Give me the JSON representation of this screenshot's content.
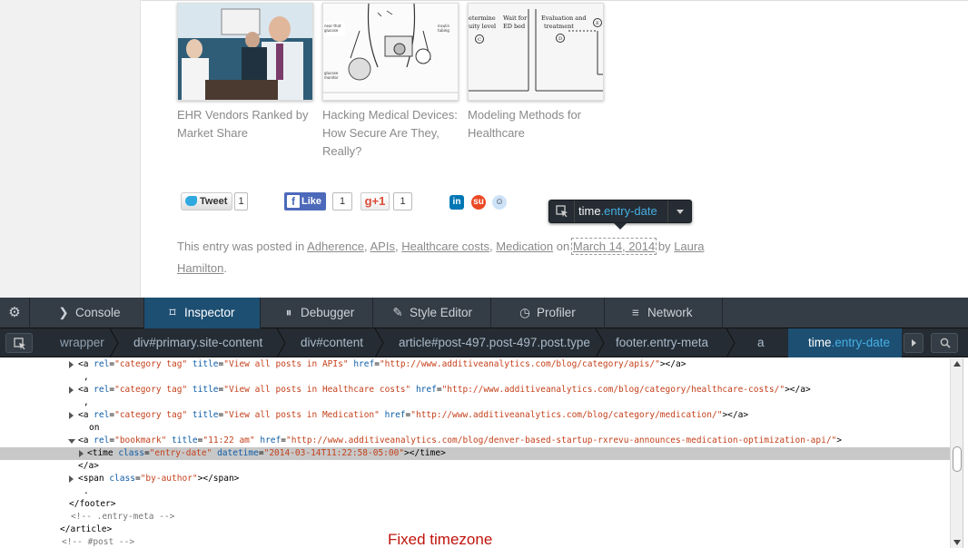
{
  "related_posts": [
    {
      "title": "EHR Vendors Ranked by Market Share"
    },
    {
      "title": "Hacking Medical Devices: How Secure Are They, Really?"
    },
    {
      "title": "Modeling Methods for Healthcare"
    }
  ],
  "thumb3_labels": {
    "a": "etermine",
    "b": "uity level",
    "c": "Wait for",
    "d": "ED bed",
    "e": "Evaluation and",
    "f": "treatment",
    "g": "C",
    "h": "D",
    "i": "E"
  },
  "share": {
    "tweet_label": "Tweet",
    "tweet_count": "1",
    "like_label": "Like",
    "like_count": "1",
    "gplus_label": "g+1",
    "gplus_count": "1"
  },
  "infobar": {
    "tag": "time",
    "class": ".entry-date"
  },
  "entry_meta": {
    "prefix": "This entry was posted in",
    "categories": [
      "Adherence",
      "APIs",
      "Healthcare costs",
      "Medication"
    ],
    "on": "on",
    "date": "March 14, 2014",
    "by": "by",
    "author_line1": "Laura",
    "author_line2": "Hamilton",
    "period": "."
  },
  "devtools": {
    "tabs": [
      {
        "label": "Console"
      },
      {
        "label": "Inspector"
      },
      {
        "label": "Debugger"
      },
      {
        "label": "Style Editor"
      },
      {
        "label": "Profiler"
      },
      {
        "label": "Network"
      }
    ],
    "breadcrumbs": {
      "wrapper": "wrapper",
      "primary_tag": "div",
      "primary_id": "#primary.site-content",
      "content_tag": "div",
      "content_id": "#content",
      "article_tag": "article",
      "article_id": "#post-497.post-497.post.type",
      "footer_tag": "footer",
      "footer_class": ".entry-meta",
      "a": "a",
      "time_tag": "time",
      "time_class": ".entry-date"
    },
    "markup": {
      "l1": {
        "rel": "category tag",
        "title": "View all posts in APIs",
        "href": "http://www.additiveanalytics.com/blog/category/apis/"
      },
      "l2": ",",
      "l3": {
        "rel": "category tag",
        "title": "View all posts in Healthcare costs",
        "href": "http://www.additiveanalytics.com/blog/category/healthcare-costs/"
      },
      "l4": ",",
      "l5": {
        "rel": "category tag",
        "title": "View all posts in Medication",
        "href": "http://www.additiveanalytics.com/blog/category/medication/"
      },
      "l6": "on",
      "l7": {
        "rel": "bookmark",
        "title": "11:22 am",
        "href": "http://www.additiveanalytics.com/blog/denver-based-startup-rxrevu-announces-medication-optimization-api/"
      },
      "l8": {
        "class": "entry-date",
        "datetime": "2014-03-14T11:22:58-05:00"
      },
      "l9": "</a>",
      "l10": {
        "class": "by-author"
      },
      "l11": ".",
      "l12": "</footer>",
      "l13": "<!-- .entry-meta -->",
      "l14": "</article>",
      "l15": "<!-- #post -->"
    },
    "annotation": "Fixed timezone"
  },
  "colors": {
    "devtools_tab_bar": "#343c45",
    "selected_tab": "#1d4f73",
    "annotation": "#c0140c",
    "attr_name": "#0d5ca6",
    "attr_value": "#c4401b"
  }
}
